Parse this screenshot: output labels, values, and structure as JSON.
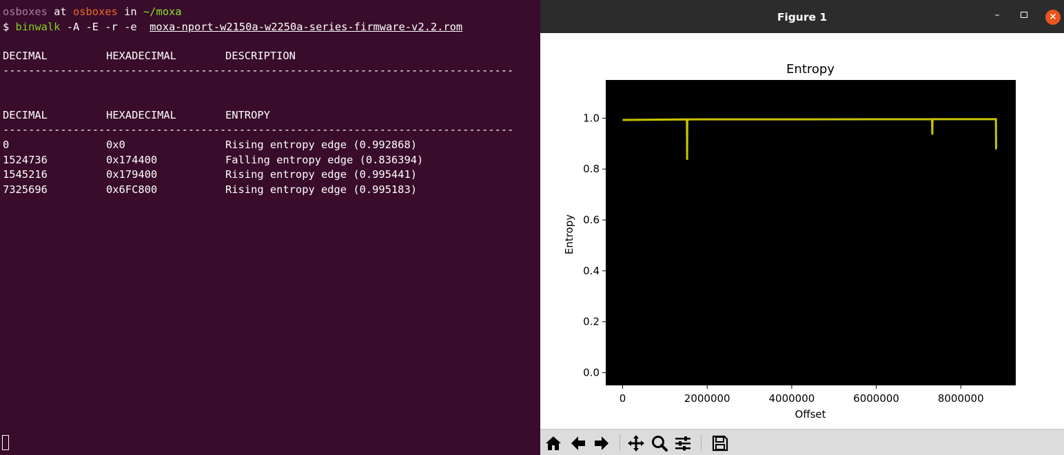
{
  "terminal": {
    "prompt": {
      "user": "osboxes",
      "at": " at ",
      "host": "osboxes",
      "in": " in ",
      "path": "~/moxa"
    },
    "command": {
      "dollar": "$ ",
      "program": "binwalk",
      "args": " -A -E -r -e  ",
      "file": "moxa-nport-w2150a-w2250a-series-firmware-v2.2.rom"
    },
    "signature_header": {
      "col1": "DECIMAL",
      "col2": "HEXADECIMAL",
      "col3": "DESCRIPTION"
    },
    "entropy_header": {
      "col1": "DECIMAL",
      "col2": "HEXADECIMAL",
      "col3": "ENTROPY"
    },
    "divider": "--------------------------------------------------------------------------------",
    "entropy_rows": [
      {
        "decimal": "0",
        "hex": "0x0",
        "entropy": "Rising entropy edge (0.992868)"
      },
      {
        "decimal": "1524736",
        "hex": "0x174400",
        "entropy": "Falling entropy edge (0.836394)"
      },
      {
        "decimal": "1545216",
        "hex": "0x179400",
        "entropy": "Rising entropy edge (0.995441)"
      },
      {
        "decimal": "7325696",
        "hex": "0x6FC800",
        "entropy": "Rising entropy edge (0.995183)"
      }
    ]
  },
  "figure_window": {
    "title": "Figure 1",
    "minimize_label": "–",
    "close_label": "✕"
  },
  "toolbar": {
    "buttons": [
      "home-icon",
      "back-arrow-icon",
      "forward-arrow-icon",
      "pan-icon",
      "zoom-icon",
      "configure-subplots-icon",
      "save-icon"
    ]
  },
  "colors": {
    "terminal_bg": "#380c2a",
    "line": "#c8c400",
    "plot_bg": "#000000"
  },
  "chart_data": {
    "type": "line",
    "title": "Entropy",
    "xlabel": "Offset",
    "ylabel": "Entropy",
    "xlim": [
      -400000,
      9300000
    ],
    "ylim": [
      -0.05,
      1.15
    ],
    "xticks": [
      0,
      2000000,
      4000000,
      6000000,
      8000000
    ],
    "xtick_labels": [
      "0",
      "2000000",
      "4000000",
      "6000000",
      "8000000"
    ],
    "yticks": [
      0.0,
      0.2,
      0.4,
      0.6,
      0.8,
      1.0
    ],
    "ytick_labels": [
      "0.0",
      "0.2",
      "0.4",
      "0.6",
      "0.8",
      "1.0"
    ],
    "series": [
      {
        "x": [
          0,
          1520000,
          1524736,
          1530000,
          1545216,
          1550000,
          7320000,
          7325696,
          7330000,
          8830000,
          8836000,
          8840000
        ],
        "y": [
          0.993,
          0.995,
          0.836,
          0.995,
          0.995,
          0.995,
          0.996,
          0.935,
          0.996,
          0.996,
          0.88,
          0.88
        ]
      }
    ]
  }
}
